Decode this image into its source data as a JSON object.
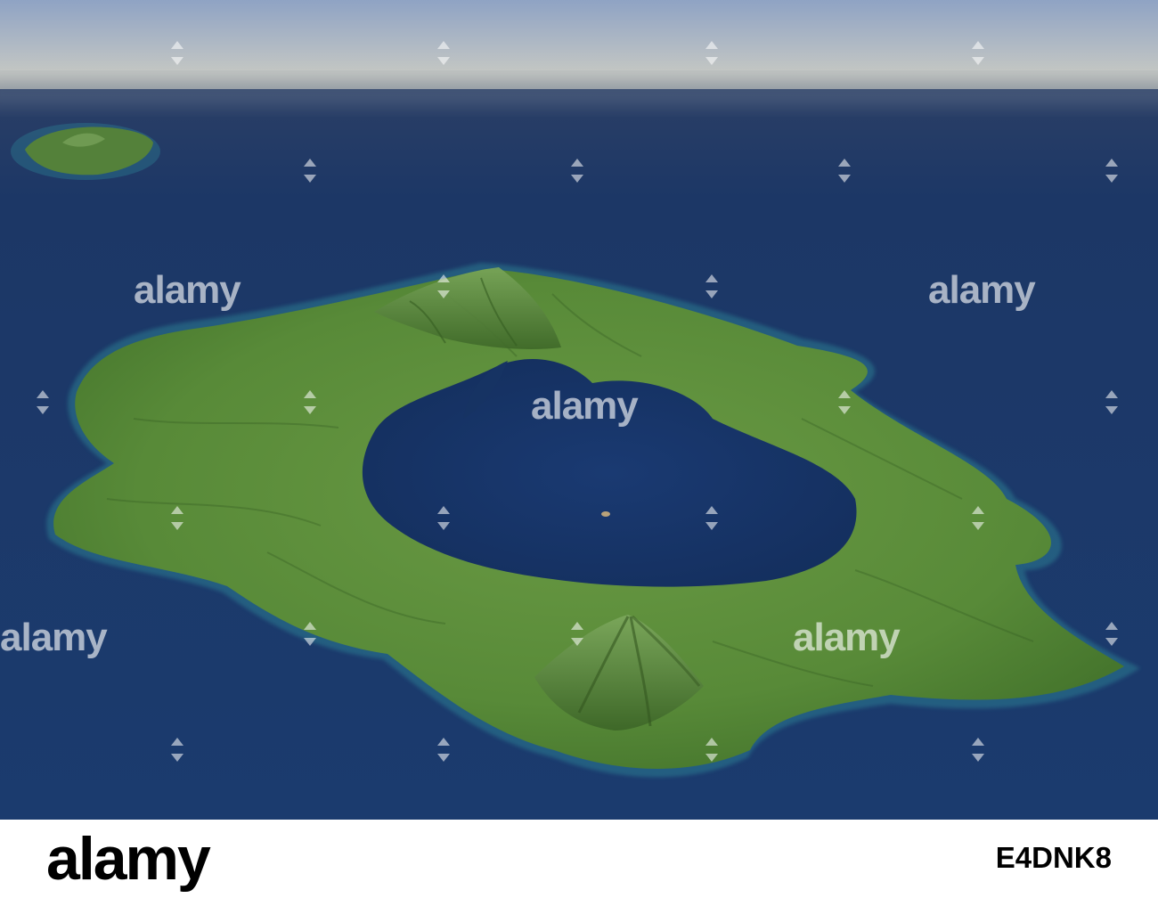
{
  "watermark": {
    "text": "alamy",
    "icon": "diamond-marker-icon"
  },
  "footer": {
    "brand": "alamy",
    "image_id": "E4DNK8"
  },
  "colors": {
    "sky_top": "#8fa3c4",
    "sky_horizon": "#d8d4c2",
    "ocean": "#1b3b6e",
    "ocean_deep": "#132c57",
    "land": "#5a8a3a",
    "land_dark": "#3f6a2a",
    "reef": "#2f8a9a",
    "footer_bg": "#ffffff",
    "footer_text": "#000000"
  }
}
